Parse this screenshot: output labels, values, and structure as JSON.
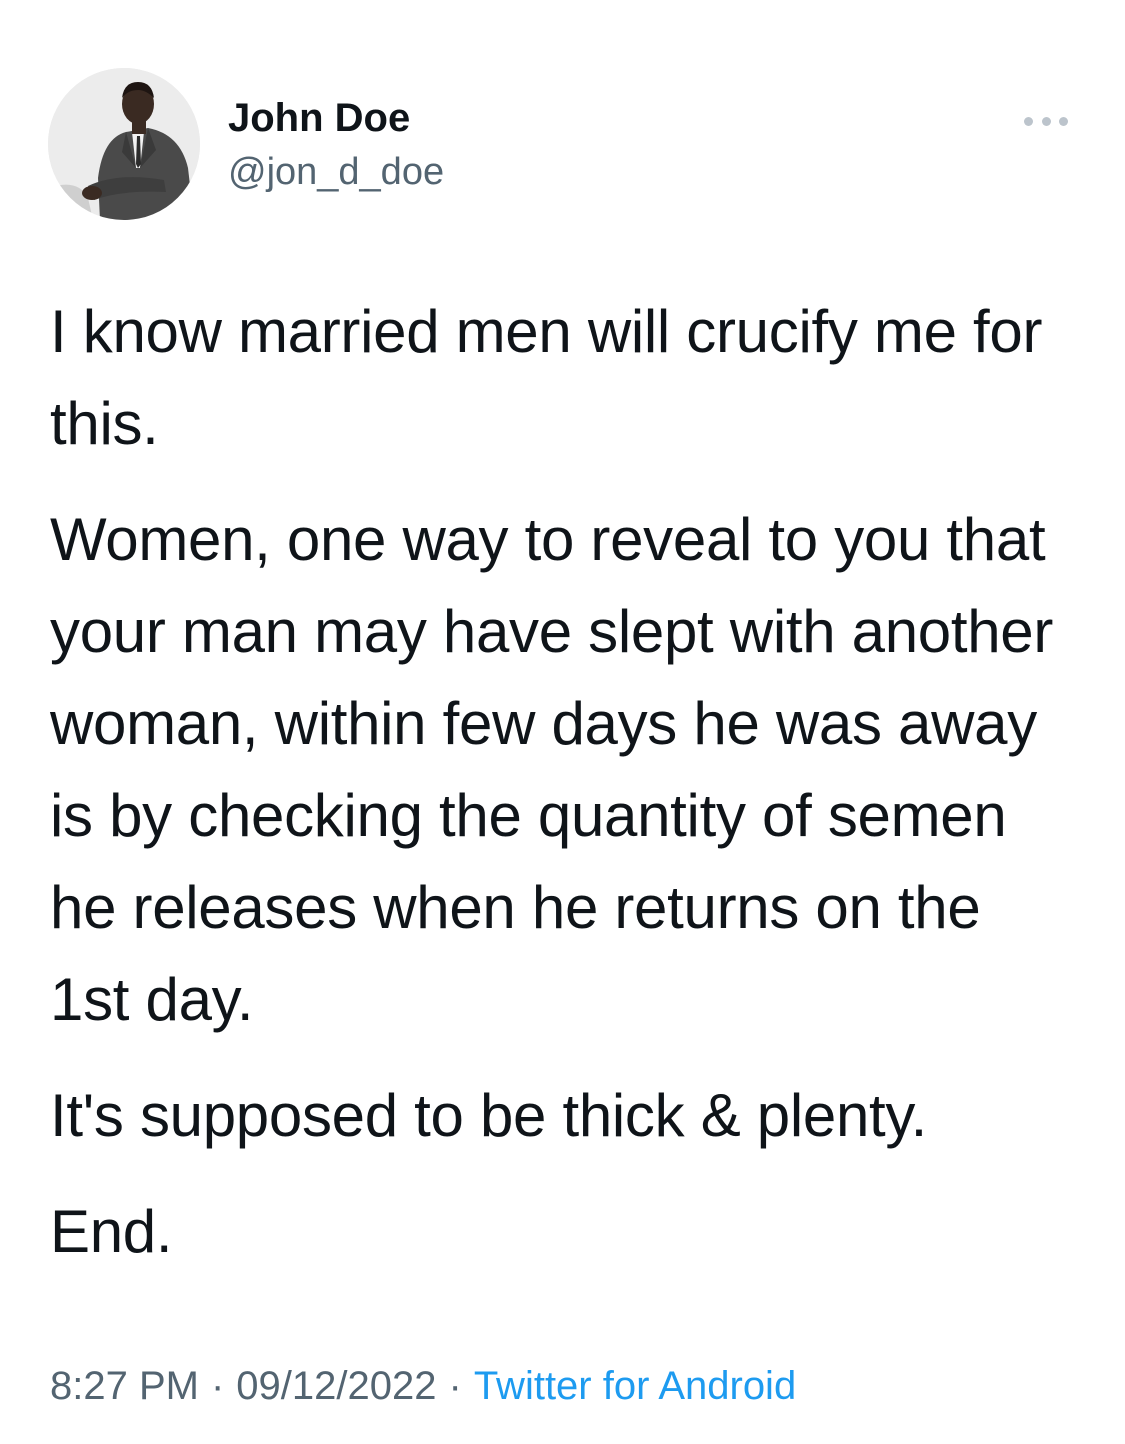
{
  "tweet": {
    "author": {
      "display_name": "John Doe",
      "handle": "@jon_d_doe"
    },
    "paragraphs": [
      "I know married men will crucify me for this.",
      "Women, one way to reveal to you that your man may have slept with another woman, within few days he was away is by checking the quantity of semen he releases when he returns on the 1st day.",
      "It's supposed to be thick & plenty.",
      "End."
    ],
    "meta": {
      "time": "8:27 PM",
      "separator": "·",
      "date": "09/12/2022",
      "source": "Twitter for Android"
    }
  },
  "icons": {
    "more": "more-horizontal-icon"
  },
  "colors": {
    "text_primary": "#0f1419",
    "text_secondary": "#536471",
    "link": "#1d9bf0",
    "more_dots": "#bcc4cc"
  }
}
